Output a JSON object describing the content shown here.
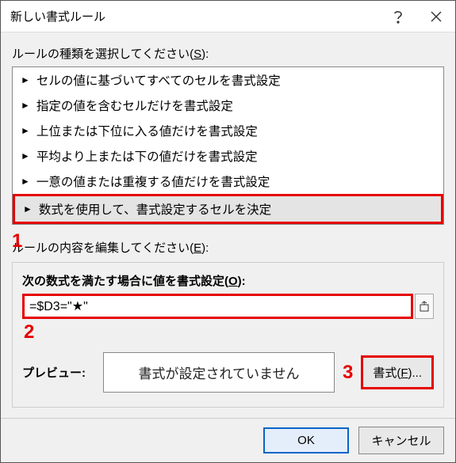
{
  "titlebar": {
    "title": "新しい書式ルール"
  },
  "labels": {
    "rule_type_prefix": "ルールの種類を選択してください(",
    "rule_type_key": "S",
    "rule_type_suffix": "):",
    "rule_edit_prefix": "ルールの内容を編集してください(",
    "rule_edit_key": "E",
    "rule_edit_suffix": "):",
    "formula_prefix": "次の数式を満たす場合に値を書式設定(",
    "formula_key": "O",
    "formula_suffix": "):",
    "preview": "プレビュー:",
    "preview_text": "書式が設定されていません",
    "format_btn_prefix": "書式(",
    "format_btn_key": "F",
    "format_btn_suffix": ")...",
    "ok": "OK",
    "cancel": "キャンセル"
  },
  "rule_types": {
    "0": "セルの値に基づいてすべてのセルを書式設定",
    "1": "指定の値を含むセルだけを書式設定",
    "2": "上位または下位に入る値だけを書式設定",
    "3": "平均より上または下の値だけを書式設定",
    "4": "一意の値または重複する値だけを書式設定",
    "5": "数式を使用して、書式設定するセルを決定"
  },
  "formula": {
    "value": "=$D3=\"★\""
  },
  "annotations": {
    "a1": "1",
    "a2": "2",
    "a3": "3"
  }
}
